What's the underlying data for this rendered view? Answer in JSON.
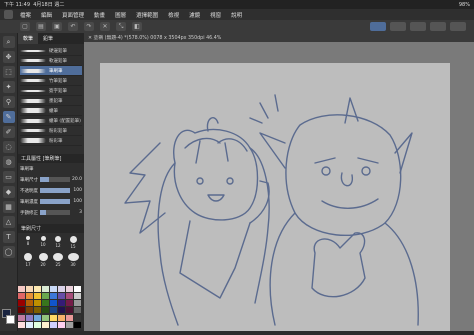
{
  "status_bar": {
    "time": "下午 11:49",
    "date": "4月18日 週二",
    "battery": "98%"
  },
  "menu": {
    "items": [
      "檔案",
      "編輯",
      "頁面管理",
      "動畫",
      "圖層",
      "選擇範圍",
      "檢視",
      "濾鏡",
      "視窗",
      "說明"
    ]
  },
  "document": {
    "tab_label": "✕ 塗鴉 (無題-4) *(578.0%) 0078 x 3504px 350dpi 46.4%"
  },
  "sub_tool": {
    "tabs": [
      "軟筆",
      "鉛筆"
    ],
    "brushes": [
      {
        "label": "硬邊鉛筆",
        "selected": false
      },
      {
        "label": "軟邊鉛筆",
        "selected": false
      },
      {
        "label": "筆刷筆",
        "selected": true
      },
      {
        "label": "竹筆鉛筆",
        "selected": false
      },
      {
        "label": "簽字鉛筆",
        "selected": false
      },
      {
        "label": "墨鉛筆",
        "selected": false
      },
      {
        "label": "蠟筆",
        "selected": false
      },
      {
        "label": "蠟筆 (配置鉛筆)",
        "selected": false
      },
      {
        "label": "粉彩鉛筆",
        "selected": false
      },
      {
        "label": "粉彩筆",
        "selected": false
      }
    ]
  },
  "tool_property": {
    "title": "工具屬性 [筆刷筆]",
    "brush_name": "筆刷筆",
    "size_label": "筆刷尺寸",
    "size_value": "20.0",
    "opacity_label": "不透明度",
    "opacity_value": "100",
    "density_label": "筆刷濃度",
    "density_value": "100",
    "stabilizer_label": "手顫修正",
    "stabilizer_value": "3"
  },
  "brush_size": {
    "title": "筆刷尺寸",
    "sizes": [
      "8",
      "10",
      "12",
      "15",
      "17",
      "20",
      "25",
      "30"
    ]
  },
  "palette_colors": [
    "#f4c7c3",
    "#f7d8b5",
    "#fde9b2",
    "#d9ead3",
    "#c9daf8",
    "#d9d2e9",
    "#ead1dc",
    "#ffffff",
    "#e06666",
    "#e69138",
    "#f1c232",
    "#6aa84f",
    "#3c78d8",
    "#674ea7",
    "#a64d79",
    "#cccccc",
    "#990000",
    "#b45f06",
    "#bf9000",
    "#38761d",
    "#1155cc",
    "#351c75",
    "#741b47",
    "#999999",
    "#660000",
    "#783f04",
    "#7f6000",
    "#274e13",
    "#1c4587",
    "#20124d",
    "#4c1130",
    "#666666",
    "#c27ba0",
    "#8e7cc3",
    "#6fa8dc",
    "#93c47d",
    "#ffd966",
    "#f6b26b",
    "#ea9999",
    "#333333",
    "#ffe0e0",
    "#e0f0ff",
    "#e0ffe0",
    "#fff0d0",
    "#d0d0ff",
    "#ffd0f0",
    "#a0a0a0",
    "#000000"
  ],
  "colors": {
    "foreground": "#1a2440",
    "background": "#ffffff",
    "accent": "#4f6d9a",
    "paper": "#bdbdbd",
    "sketch": "#5b6b8f"
  }
}
